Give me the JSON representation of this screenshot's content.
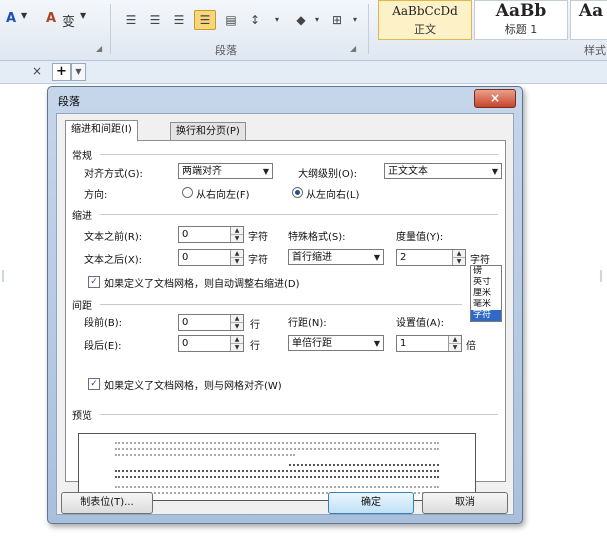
{
  "ribbon": {
    "font_color_glyph": "A",
    "highlight_glyph": "A",
    "char_glyph": "变",
    "paragraph_group_label": "段落",
    "styles": [
      {
        "preview": "AaBbCcDd",
        "name": "正文"
      },
      {
        "preview": "AaBb",
        "name": "标题 1"
      },
      {
        "preview": "Aa",
        "name": ""
      }
    ],
    "styles_group_label": "样式"
  },
  "tabbar": {
    "close": "×",
    "new": "+"
  },
  "dialog": {
    "title": "段落",
    "close": "×",
    "tabs": [
      "缩进和间距(I)",
      "换行和分页(P)"
    ],
    "general": {
      "section": "常规",
      "align_label": "对齐方式(G):",
      "align_value": "两端对齐",
      "outline_label": "大纲级别(O):",
      "outline_value": "正文文本",
      "direction_label": "方向:",
      "rtl": "从右向左(F)",
      "ltr": "从左向右(L)"
    },
    "indent": {
      "section": "缩进",
      "before_label": "文本之前(R):",
      "before_value": "0",
      "after_label": "文本之后(X):",
      "after_value": "0",
      "unit": "字符",
      "special_label": "特殊格式(S):",
      "special_value": "首行缩进",
      "measure_label": "度量值(Y):",
      "measure_value": "2",
      "measure_unit": "字符",
      "unit_options": [
        "磅",
        "英寸",
        "厘米",
        "毫米",
        "字符"
      ],
      "auto_adjust": "如果定义了文档网格，则自动调整右缩进(D)"
    },
    "spacing": {
      "section": "间距",
      "before_label": "段前(B):",
      "before_value": "0",
      "after_label": "段后(E):",
      "after_value": "0",
      "unit": "行",
      "line_label": "行距(N):",
      "line_value": "单倍行距",
      "set_label": "设置值(A):",
      "set_value": "1",
      "set_unit": "倍",
      "snap_grid": "如果定义了文档网格，则与网格对齐(W)"
    },
    "preview_label": "预览",
    "buttons": {
      "tabs": "制表位(T)...",
      "ok": "确定",
      "cancel": "取消"
    }
  }
}
